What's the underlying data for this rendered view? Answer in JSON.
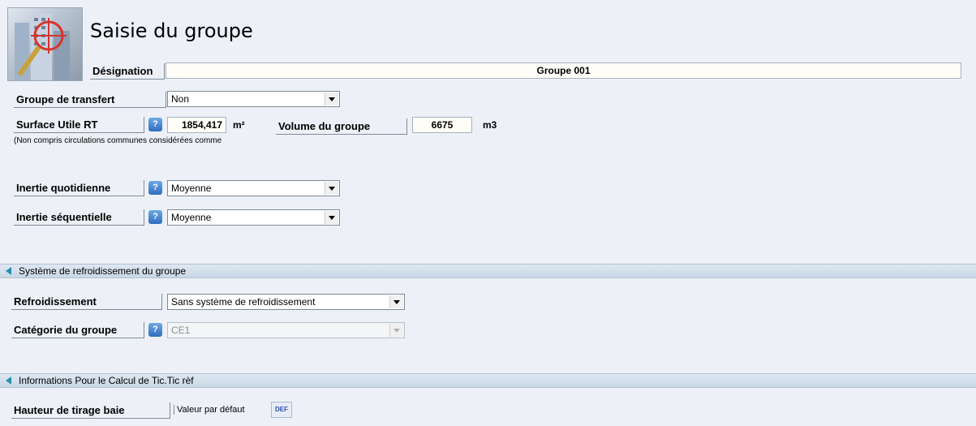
{
  "header": {
    "title": "Saisie du groupe",
    "logo_icon": "building-target-icon"
  },
  "designation": {
    "label": "Désignation",
    "value": "Groupe 001"
  },
  "groupe_transfert": {
    "label": "Groupe de transfert",
    "value": "Non"
  },
  "surface": {
    "label": "Surface Utile RT",
    "value": "1854,417",
    "unit": "m²",
    "note": "(Non compris circulations communes considérées comme"
  },
  "volume": {
    "label": "Volume du groupe",
    "value": "6675",
    "unit": "m3"
  },
  "inertie_quotidienne": {
    "label": "Inertie quotidienne",
    "value": "Moyenne"
  },
  "inertie_sequentielle": {
    "label": "Inertie séquentielle",
    "value": "Moyenne"
  },
  "section_refroidissement": {
    "title": "Système de refroidissement du groupe"
  },
  "refroidissement": {
    "label": "Refroidissement",
    "value": "Sans système de refroidissement"
  },
  "categorie": {
    "label": "Catégorie du groupe",
    "value": "CE1"
  },
  "section_tic": {
    "title": "Informations Pour le Calcul de Tic.Tic rèf"
  },
  "hauteur": {
    "label": "Hauteur de tirage baie",
    "value": "Valeur par défaut",
    "def_button": "DEF"
  },
  "help_glyph": "?",
  "colors": {
    "background": "#edf1f7",
    "section": "#c9d7e6",
    "help_button": "#2f6dc0"
  }
}
